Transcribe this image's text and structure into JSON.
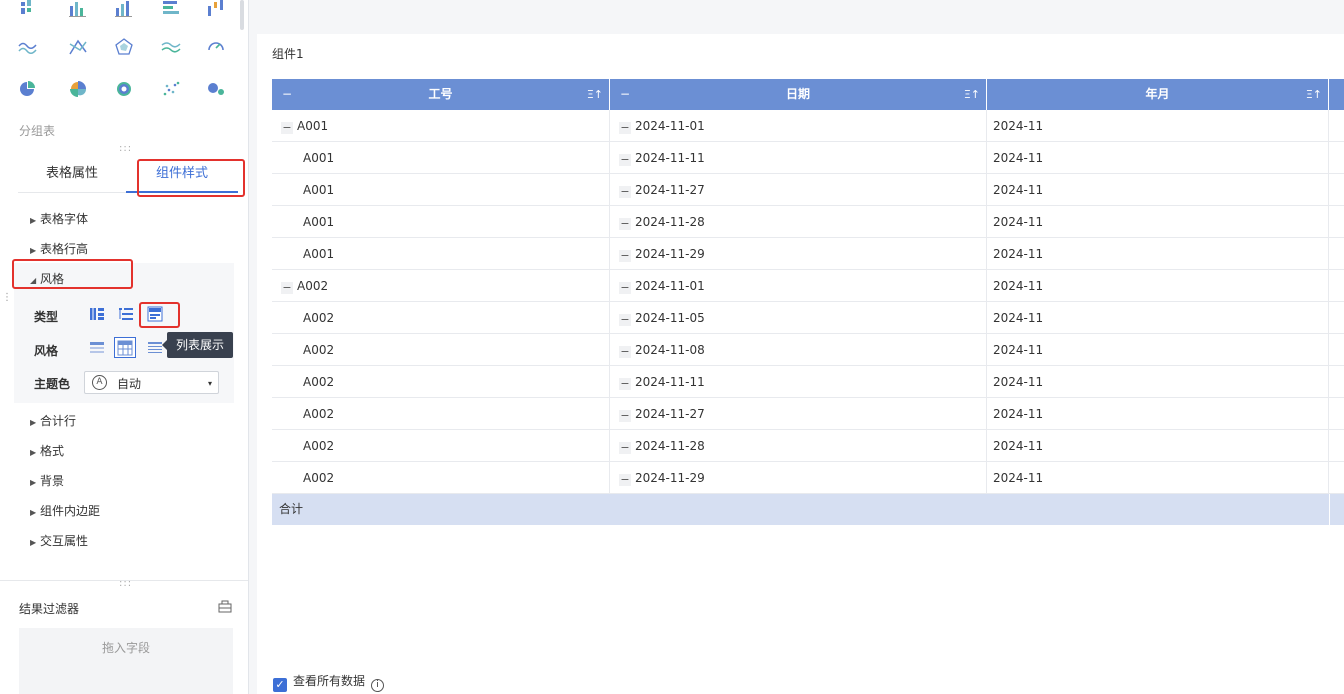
{
  "sidebar": {
    "chart_icons": [
      [
        "scatter-grid-icon",
        "bar-chart-icon",
        "grouped-bar-icon",
        "horizontal-bar-icon",
        "range-bar-icon"
      ],
      [
        "wave-line-icon",
        "cross-line-icon",
        "radar-icon",
        "area-line-icon",
        "gauge-icon"
      ],
      [
        "pie-chart-icon",
        "rose-chart-icon",
        "donut-chart-icon",
        "scatter-plot-icon",
        "bubble-chart-icon"
      ]
    ],
    "section_title": "分组表",
    "tabs": {
      "table_props": "表格属性",
      "component_style": "组件样式"
    },
    "props": {
      "table_font": "表格字体",
      "table_row_height": "表格行高",
      "style": "风格",
      "total_row": "合计行",
      "format": "格式",
      "background": "背景",
      "padding": "组件内边距",
      "interaction": "交互属性"
    },
    "style_panel": {
      "type_label": "类型",
      "style_label": "风格",
      "theme_label": "主题色",
      "theme_value": "自动",
      "theme_icon_letter": "A",
      "tooltip": "列表展示"
    },
    "filter": {
      "title": "结果过滤器",
      "dropzone": "拖入字段"
    }
  },
  "main": {
    "component_title": "组件1",
    "columns": [
      {
        "name": "工号",
        "minus": "−",
        "sort": "Ξ↑"
      },
      {
        "name": "日期",
        "minus": "−",
        "sort": "Ξ↑"
      },
      {
        "name": "年月",
        "minus": "",
        "sort": "Ξ↑"
      }
    ],
    "rows": [
      {
        "id": "A001",
        "date": "2024-11-01",
        "ym": "2024-11",
        "group": true
      },
      {
        "id": "A001",
        "date": "2024-11-11",
        "ym": "2024-11",
        "group": false
      },
      {
        "id": "A001",
        "date": "2024-11-27",
        "ym": "2024-11",
        "group": false
      },
      {
        "id": "A001",
        "date": "2024-11-28",
        "ym": "2024-11",
        "group": false
      },
      {
        "id": "A001",
        "date": "2024-11-29",
        "ym": "2024-11",
        "group": false
      },
      {
        "id": "A002",
        "date": "2024-11-01",
        "ym": "2024-11",
        "group": true
      },
      {
        "id": "A002",
        "date": "2024-11-05",
        "ym": "2024-11",
        "group": false
      },
      {
        "id": "A002",
        "date": "2024-11-08",
        "ym": "2024-11",
        "group": false
      },
      {
        "id": "A002",
        "date": "2024-11-11",
        "ym": "2024-11",
        "group": false
      },
      {
        "id": "A002",
        "date": "2024-11-27",
        "ym": "2024-11",
        "group": false
      },
      {
        "id": "A002",
        "date": "2024-11-28",
        "ym": "2024-11",
        "group": false
      },
      {
        "id": "A002",
        "date": "2024-11-29",
        "ym": "2024-11",
        "group": false
      }
    ],
    "total_label": "合计",
    "view_all": "查看所有数据",
    "info_glyph": "i",
    "collapse_glyph": "−",
    "check_glyph": "✓"
  },
  "colors": {
    "header": "#6b8fd4",
    "total": "#d6dff2",
    "accent": "#3d6fd6",
    "highlight": "#e3322d"
  }
}
